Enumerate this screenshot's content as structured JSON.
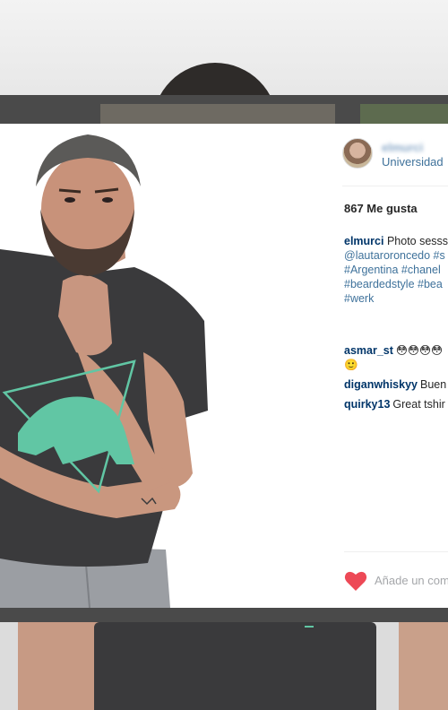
{
  "post": {
    "username": "elmurci",
    "location": "Universidad",
    "likes_text": "867 Me gusta"
  },
  "caption": {
    "user": "elmurci",
    "lines": [
      "Photo sesss",
      "@lautaroroncedo #s",
      "#Argentina #chanel",
      "#beardedstyle #bea",
      "#werk"
    ]
  },
  "comments": [
    {
      "user": "asmar_st",
      "text": "😳😳😳😳",
      "text2": "🙂"
    },
    {
      "user": "diganwhiskyy",
      "text": "Buen"
    },
    {
      "user": "quirky13",
      "text": "Great tshir"
    }
  ],
  "input": {
    "placeholder": "Añade un com"
  },
  "colors": {
    "link": "#3f729b",
    "username": "#003569",
    "heart": "#ed4956",
    "shirt": "#3a3a3c",
    "print": "#61c6a4"
  },
  "icons": [
    "heart-icon"
  ]
}
